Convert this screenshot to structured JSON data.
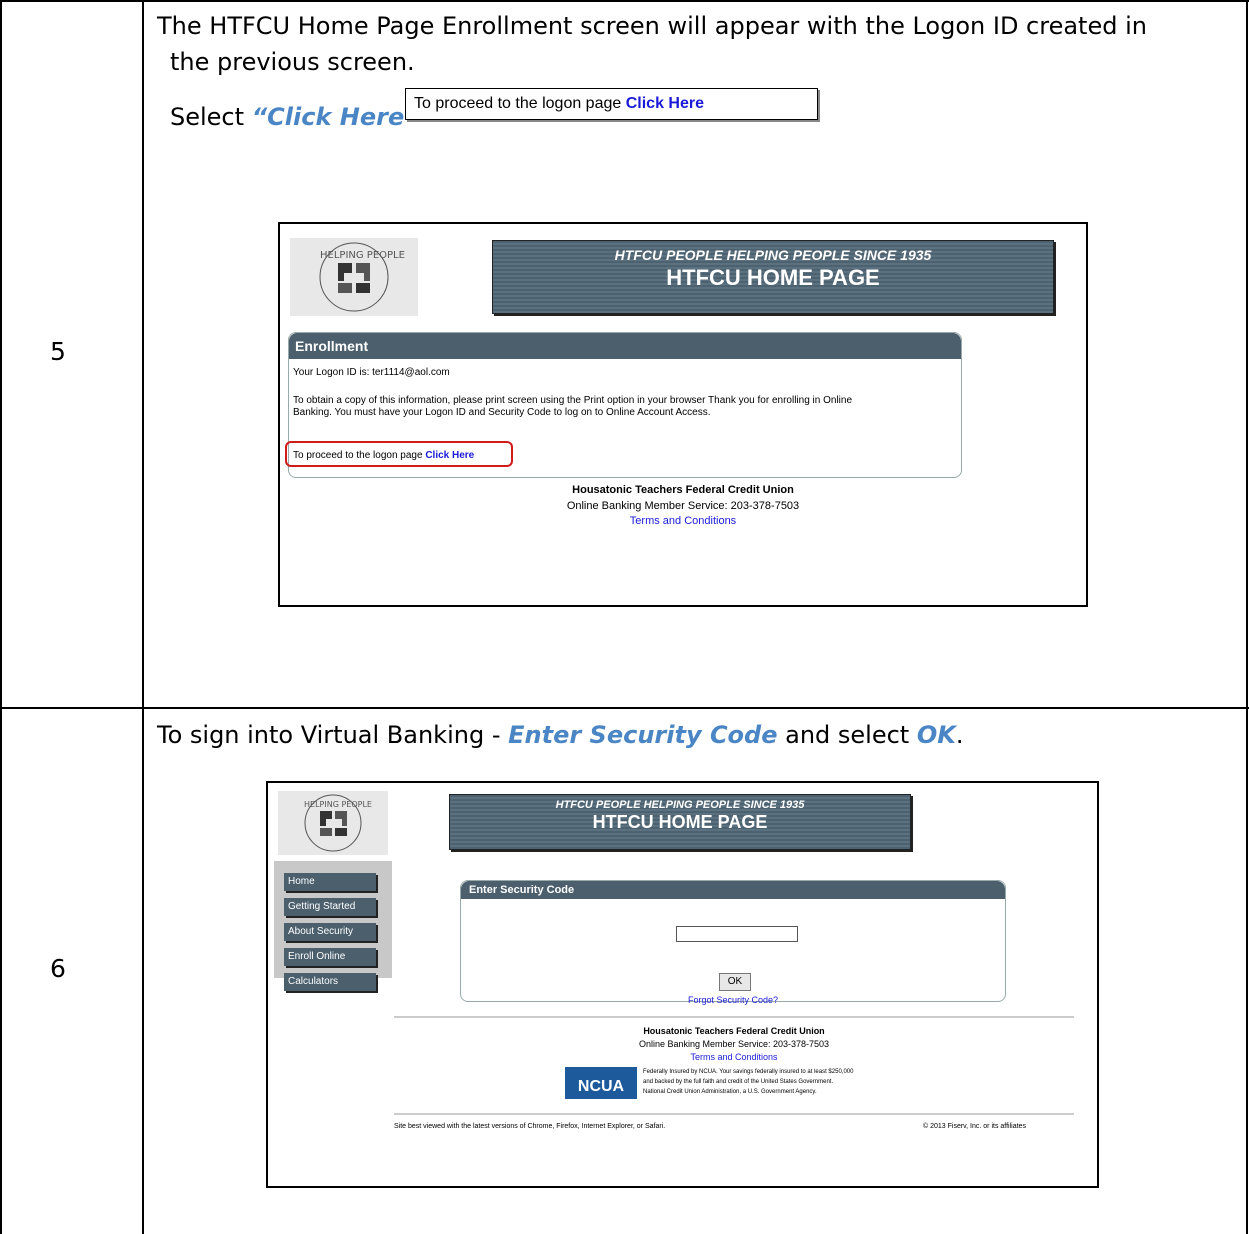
{
  "step5": {
    "number": "5",
    "line1": "The HTFCU Home Page Enrollment screen will appear with the Logon ID created in",
    "line2": "the previous screen.",
    "select_word": "Select",
    "select_target": "“Click Here”",
    "callout": {
      "text": "To proceed to the logon page",
      "link": "Click Here"
    },
    "screenshot": {
      "banner_sub": "HTFCU PEOPLE HELPING PEOPLE SINCE 1935",
      "banner_main": "HTFCU HOME PAGE",
      "panel_title": "Enrollment",
      "logon_id": "Your Logon ID is: ter1114@aol.com",
      "info_line1": "To obtain a copy of this information, please print screen using the Print option in your browser Thank you for enrolling in Online",
      "info_line2": "Banking. You must have your Logon ID and Security Code to log on to Online Account Access.",
      "proceed_text": "To proceed to the logon page",
      "proceed_link": "Click Here",
      "footer_name": "Housatonic Teachers Federal Credit Union",
      "footer_service": "Online Banking Member Service: 203-378-7503",
      "footer_terms": "Terms and Conditions"
    }
  },
  "step6": {
    "number": "6",
    "instr_prefix": "To sign into Virtual Banking - ",
    "instr_code": "Enter Security Code",
    "instr_mid": " and select ",
    "instr_ok": "OK",
    "instr_end": ".",
    "screenshot": {
      "banner_sub": "HTFCU PEOPLE HELPING PEOPLE SINCE 1935",
      "banner_main": "HTFCU HOME PAGE",
      "nav": [
        "Home",
        "Getting Started",
        "About Security",
        "Enroll Online",
        "Calculators"
      ],
      "panel_title": "Enter Security Code",
      "ok_label": "OK",
      "forgot_link": "Forgot Security Code?",
      "footer_name": "Housatonic Teachers Federal Credit Union",
      "footer_service": "Online Banking Member Service: 203-378-7503",
      "footer_terms": "Terms and Conditions",
      "ncua_logo": "NCUA",
      "ncua_text1": "Federally Insured by NCUA. Your savings federally insured to at least $250,000",
      "ncua_text2": "and backed by the full faith and credit of the United States Government.",
      "ncua_text3": "National Credit Union Administration, a U.S. Government Agency.",
      "browser_note": "Site best viewed with the latest versions of Chrome, Firefox, Internet Explorer, or Safari.",
      "copyright": "© 2013 Fiserv, Inc. or its affiliates"
    }
  },
  "colors": {
    "highlight": "#4a86c5",
    "banner": "#4d6270",
    "link": "#1a1ad8",
    "callout_red": "#d11a1a"
  }
}
